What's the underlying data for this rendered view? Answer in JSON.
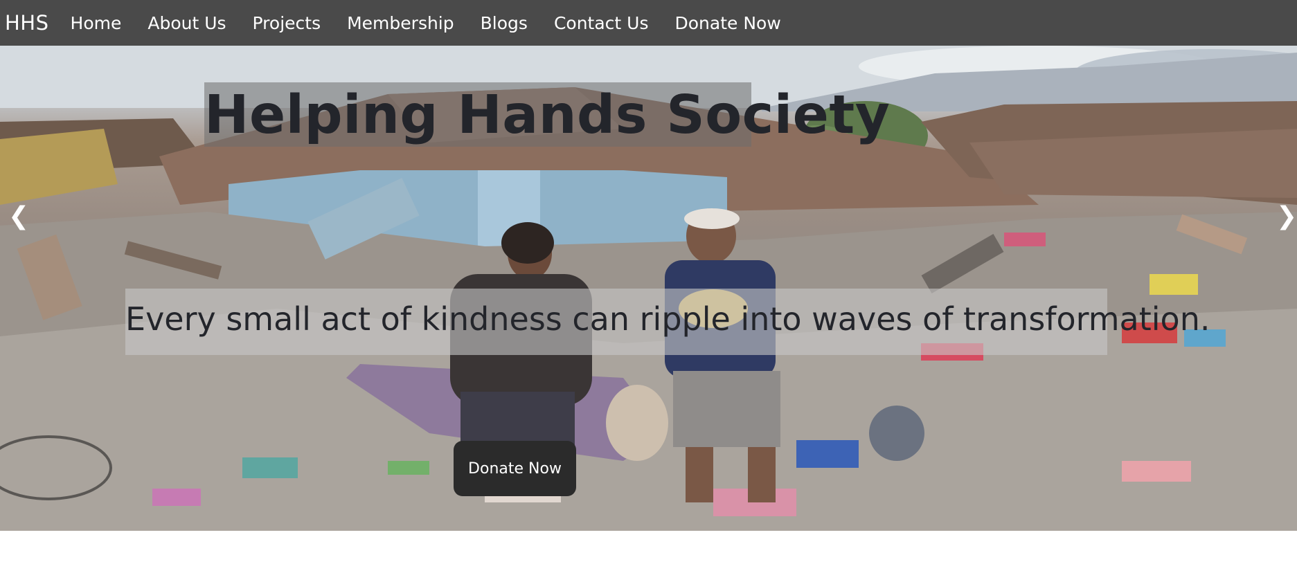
{
  "nav": {
    "brand": "HHS",
    "links": [
      "Home",
      "About Us",
      "Projects",
      "Membership",
      "Blogs",
      "Contact Us",
      "Donate Now"
    ]
  },
  "hero": {
    "title": "Helping Hands Society",
    "tagline": "Every small act of kindness can ripple into waves of transformation.",
    "cta_label": "Donate Now",
    "prev_arrow": "❮",
    "next_arrow": "❯",
    "image_subject": "people standing amid rubble after a disaster"
  },
  "colors": {
    "navbar": "#4a4a4a",
    "button": "#2b2b2b",
    "text_dark": "#23252b"
  }
}
